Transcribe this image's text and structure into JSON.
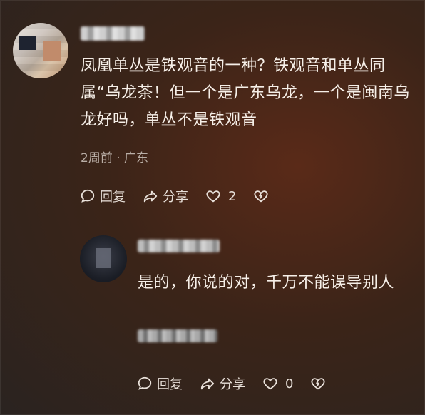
{
  "comment": {
    "text": "凤凰单丛是铁观音的一种？铁观音和单丛同属“乌龙茶！但一个是广东乌龙，一个是闽南乌龙好吗，单丛不是铁观音",
    "meta": "2周前 · 广东",
    "actions": {
      "reply_label": "回复",
      "share_label": "分享",
      "like_count": "2"
    }
  },
  "reply": {
    "text": "是的，你说的对，千万不能误导别人",
    "actions": {
      "reply_label": "回复",
      "share_label": "分享",
      "like_count": "0"
    }
  },
  "icons": {
    "reply": "comment-bubble-icon",
    "share": "share-arrow-icon",
    "like": "heart-icon",
    "dislike": "broken-heart-icon"
  }
}
